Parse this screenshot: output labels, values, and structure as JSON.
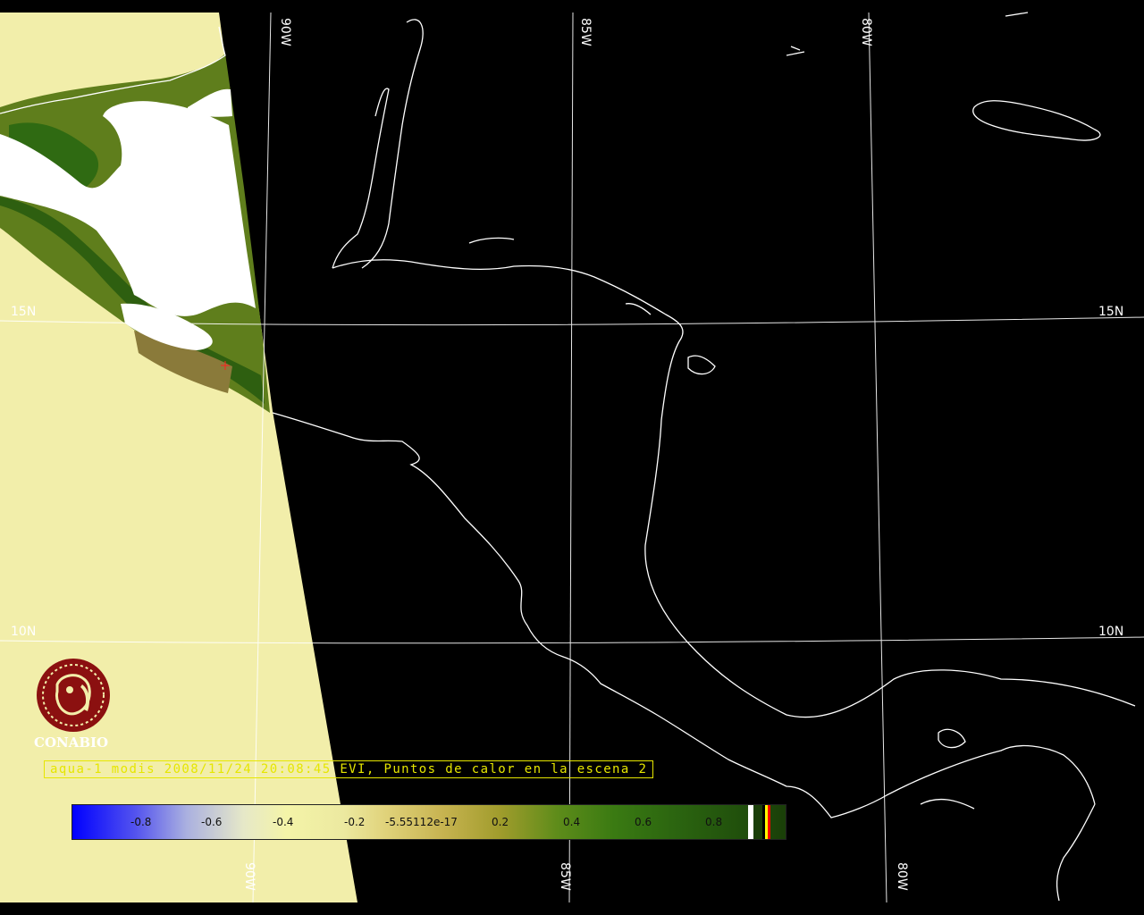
{
  "map": {
    "grid_labels": {
      "lon_top": [
        "90W",
        "85W",
        "80W"
      ],
      "lon_bottom": [
        "90W",
        "85W",
        "80W"
      ],
      "lat_left": [
        "15N",
        "10N"
      ],
      "lat_right": [
        "15N",
        "10N"
      ]
    },
    "colors": {
      "background": "#000000",
      "swath_fill": "#f2eeaa",
      "coastline": "#ffffff",
      "grid": "#ffffff",
      "hotspot_marker": "#ff2020"
    }
  },
  "logo": {
    "name": "CONABIO",
    "icon": "conabio-seal-icon",
    "color": "#8b1010"
  },
  "caption": {
    "text": "aqua-1 modis 2008/11/24 20:08:45 EVI, Puntos de calor en la escena 2"
  },
  "colorbar": {
    "ticks": [
      "-0.8",
      "-0.6",
      "-0.4",
      "-0.2",
      "-5.55112e-17",
      "0.2",
      "0.4",
      "0.6",
      "0.8"
    ],
    "stripe_colors": [
      "#ffffff",
      "#000000",
      "#ffff00",
      "#ff0000"
    ]
  }
}
